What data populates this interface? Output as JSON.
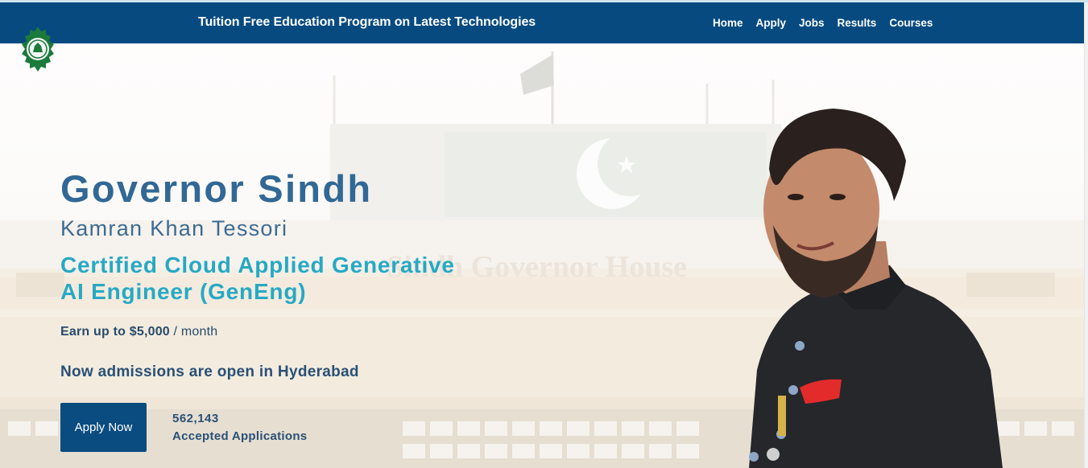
{
  "navbar": {
    "title": "Tuition Free Education Program on Latest Technologies",
    "links": [
      {
        "label": "Home",
        "icon": ""
      },
      {
        "label": "Apply"
      },
      {
        "label": "Jobs"
      },
      {
        "label": "Results"
      },
      {
        "label": "Courses"
      }
    ]
  },
  "logo": {
    "icon": "governor-house-emblem"
  },
  "hero": {
    "title": "Governor Sindh",
    "subtitle": "Kamran Khan Tessori",
    "program_line1": "Certified Cloud Applied Generative",
    "program_line2": "AI Engineer (GenEng)",
    "earn_prefix": "Earn up to $5,000",
    "earn_suffix": " / month",
    "admissions": "Now admissions are open in Hyderabad",
    "apply_button": "Apply Now",
    "applications_count": "562,143",
    "applications_label": "Accepted Applications",
    "background_sign": "Sindh Governor House"
  },
  "colors": {
    "navbar": "#064a80",
    "title": "#316895",
    "accent": "#27a9c4",
    "button": "#0a4b80"
  }
}
